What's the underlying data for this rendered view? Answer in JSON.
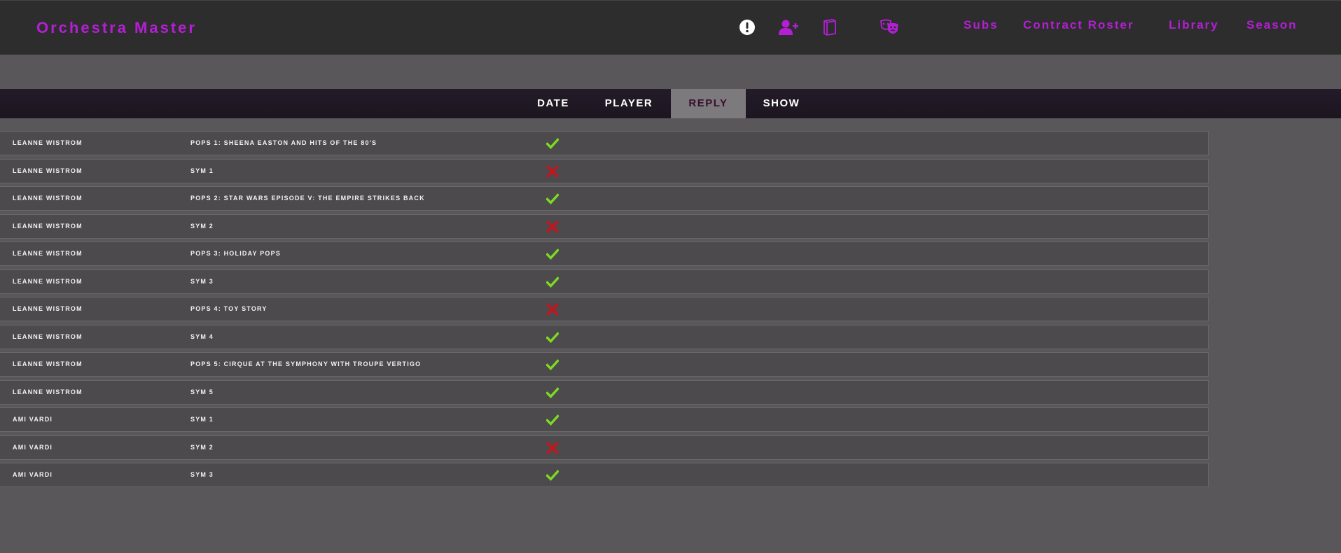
{
  "app": {
    "title": "Orchestra Master"
  },
  "header": {
    "icons": [
      {
        "name": "alert-icon"
      },
      {
        "name": "add-user-icon"
      },
      {
        "name": "book-icon"
      },
      {
        "name": "theater-masks-icon"
      }
    ],
    "nav": [
      {
        "label": "Subs"
      },
      {
        "label": "Contract Roster"
      },
      {
        "label": "Library"
      },
      {
        "label": "Season"
      }
    ]
  },
  "tabs": [
    {
      "label": "DATE",
      "active": false
    },
    {
      "label": "PLAYER",
      "active": false
    },
    {
      "label": "REPLY",
      "active": true
    },
    {
      "label": "SHOW",
      "active": false
    }
  ],
  "colors": {
    "accent": "#b41fd6",
    "yes": "#7bdc1f",
    "no": "#c4141c"
  },
  "rows": [
    {
      "player": "LEANNE WISTROM",
      "show": "POPS 1: SHEENA EASTON AND HITS OF THE 80'S",
      "reply": "yes"
    },
    {
      "player": "LEANNE WISTROM",
      "show": "SYM 1",
      "reply": "no"
    },
    {
      "player": "LEANNE WISTROM",
      "show": "POPS 2: STAR WARS EPISODE V: THE EMPIRE STRIKES BACK",
      "reply": "yes"
    },
    {
      "player": "LEANNE WISTROM",
      "show": "SYM 2",
      "reply": "no"
    },
    {
      "player": "LEANNE WISTROM",
      "show": "POPS 3: HOLIDAY POPS",
      "reply": "yes"
    },
    {
      "player": "LEANNE WISTROM",
      "show": "SYM 3",
      "reply": "yes"
    },
    {
      "player": "LEANNE WISTROM",
      "show": "POPS 4: TOY STORY",
      "reply": "no"
    },
    {
      "player": "LEANNE WISTROM",
      "show": "SYM 4",
      "reply": "yes"
    },
    {
      "player": "LEANNE WISTROM",
      "show": "POPS 5: CIRQUE AT THE SYMPHONY WITH TROUPE VERTIGO",
      "reply": "yes"
    },
    {
      "player": "LEANNE WISTROM",
      "show": "SYM 5",
      "reply": "yes"
    },
    {
      "player": "AMI VARDI",
      "show": "SYM 1",
      "reply": "yes"
    },
    {
      "player": "AMI VARDI",
      "show": "SYM 2",
      "reply": "no"
    },
    {
      "player": "AMI VARDI",
      "show": "SYM 3",
      "reply": "yes"
    }
  ]
}
